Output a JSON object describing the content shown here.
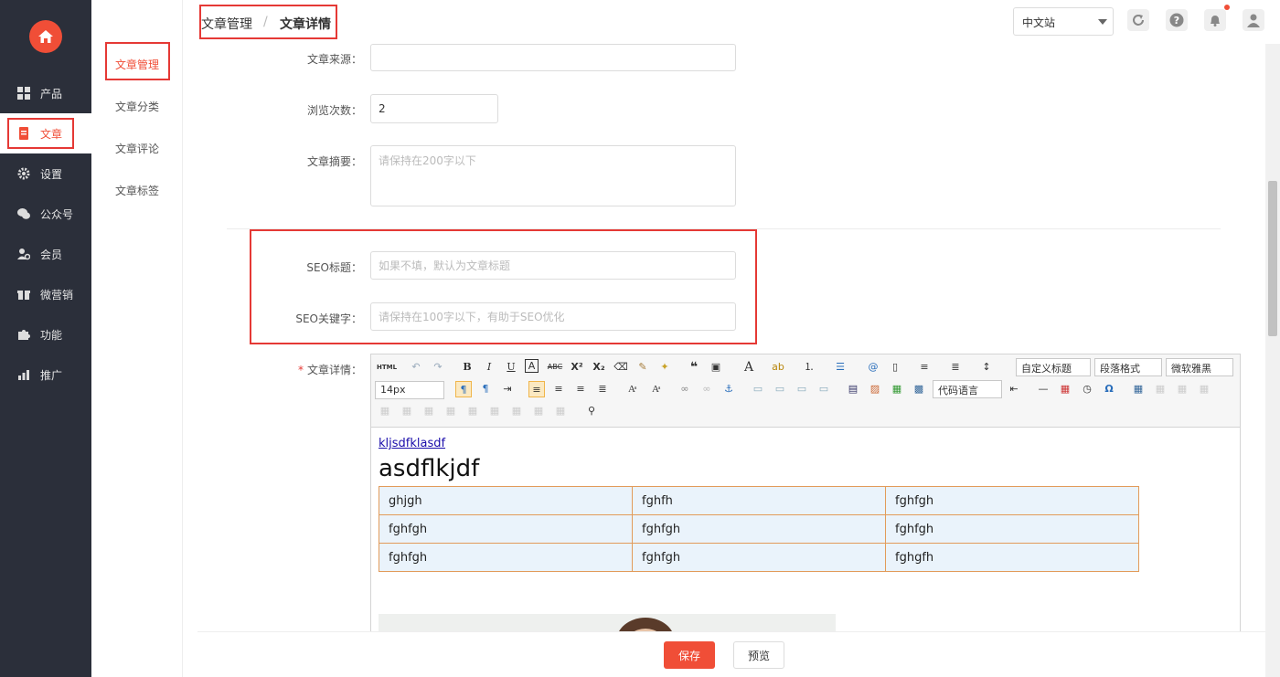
{
  "sidebar": {
    "items": [
      {
        "label": "产品",
        "icon": "grid-icon"
      },
      {
        "label": "文章",
        "icon": "document-icon"
      },
      {
        "label": "设置",
        "icon": "gear-icon"
      },
      {
        "label": "公众号",
        "icon": "wechat-icon"
      },
      {
        "label": "会员",
        "icon": "member-icon"
      },
      {
        "label": "微营销",
        "icon": "gift-icon"
      },
      {
        "label": "功能",
        "icon": "puzzle-icon"
      },
      {
        "label": "推广",
        "icon": "chart-icon"
      }
    ]
  },
  "subnav": {
    "items": [
      {
        "label": "文章管理"
      },
      {
        "label": "文章分类"
      },
      {
        "label": "文章评论"
      },
      {
        "label": "文章标签"
      }
    ]
  },
  "header": {
    "breadcrumb": [
      "文章管理",
      "/",
      "文章详情"
    ],
    "site_select": "中文站"
  },
  "form": {
    "source_label": "文章来源：",
    "source_value": "",
    "views_label": "浏览次数：",
    "views_value": "2",
    "summary_label": "文章摘要：",
    "summary_placeholder": "请保持在200字以下",
    "seo_title_label": "SEO标题：",
    "seo_title_placeholder": "如果不填，默认为文章标题",
    "seo_keywords_label": "SEO关键字：",
    "seo_keywords_placeholder": "请保持在100字以下，有助于SEO优化",
    "detail_required": "*",
    "detail_label": "文章详情："
  },
  "editor": {
    "toolbar": {
      "html": "HTML",
      "custom_title": "自定义标题",
      "paragraph": "段落格式",
      "font": "微软雅黑",
      "size": "14px",
      "code_lang": "代码语言"
    },
    "content": {
      "link": "kljsdfklasdf",
      "heading": "asdflkjdf",
      "table": [
        [
          "ghjgh",
          "fghfh",
          "fghfgh"
        ],
        [
          "fghfgh",
          "fghfgh",
          "fghfgh"
        ],
        [
          "fghfgh",
          "fghfgh",
          "fghgfh"
        ]
      ]
    }
  },
  "actions": {
    "save": "保存",
    "preview": "预览"
  },
  "colors": {
    "accent": "#f04e37",
    "sidebar_bg": "#2b2f3a",
    "highlight_box": "#e53935"
  }
}
